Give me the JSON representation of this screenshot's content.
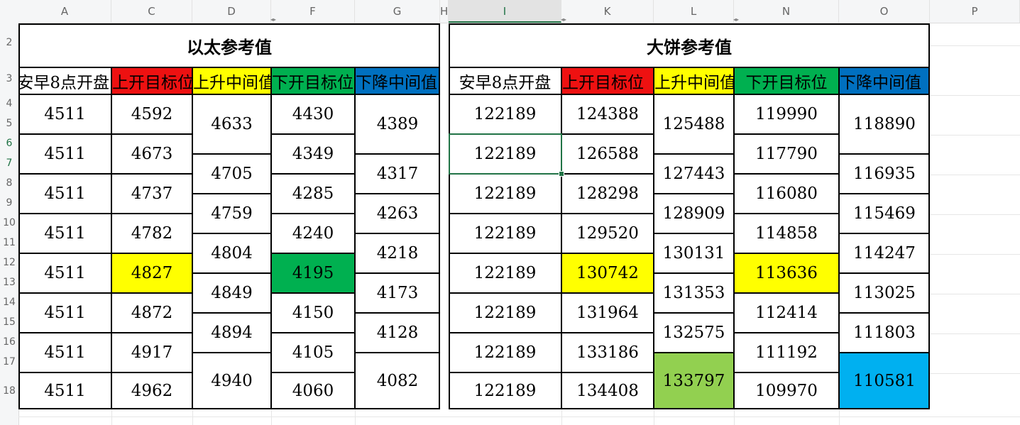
{
  "columns": {
    "left": [
      "A",
      "C",
      "D",
      "F",
      "G"
    ],
    "gap": "H",
    "right": [
      "I",
      "K",
      "L",
      "N",
      "O"
    ],
    "extra": "P",
    "selected": "I"
  },
  "rows": {
    "labels": [
      "2",
      "3",
      "4",
      "5",
      "6",
      "7",
      "8",
      "9",
      "10",
      "11",
      "12",
      "13",
      "14",
      "15",
      "16",
      "17",
      "18"
    ],
    "selected": [
      "6",
      "7"
    ]
  },
  "eth": {
    "title": "以太参考值",
    "headers": [
      "安早8点开盘",
      "上开目标位",
      "上升中间值",
      "下开目标位",
      "下降中间值"
    ],
    "open": [
      "4511",
      "4511",
      "4511",
      "4511",
      "4511",
      "4511",
      "4511",
      "4511"
    ],
    "up_target": [
      "4592",
      "4673",
      "4737",
      "4782",
      "4827",
      "4872",
      "4917",
      "4962"
    ],
    "up_mid": [
      "4633",
      "4705",
      "4759",
      "4804",
      "4849",
      "4894",
      "4940"
    ],
    "down_target": [
      "4430",
      "4349",
      "4285",
      "4240",
      "4195",
      "4150",
      "4105",
      "4060"
    ],
    "down_mid": [
      "4389",
      "4317",
      "4263",
      "4218",
      "4173",
      "4128",
      "4082"
    ]
  },
  "btc": {
    "title": "大饼参考值",
    "headers": [
      "安早8点开盘",
      "上开目标位",
      "上升中间值",
      "下开目标位",
      "下降中间值"
    ],
    "open": [
      "122189",
      "122189",
      "122189",
      "122189",
      "122189",
      "122189",
      "122189",
      "122189"
    ],
    "up_target": [
      "124388",
      "126588",
      "128298",
      "129520",
      "130742",
      "131964",
      "133186",
      "134408"
    ],
    "up_mid": [
      "125488",
      "127443",
      "128909",
      "130131",
      "131353",
      "132575",
      "133797"
    ],
    "down_target": [
      "119990",
      "117790",
      "116080",
      "114858",
      "113636",
      "112414",
      "111192",
      "109970"
    ],
    "down_mid": [
      "118890",
      "116935",
      "115469",
      "114247",
      "113025",
      "111803",
      "110581"
    ]
  },
  "colors": {
    "red": "#ee1111",
    "yellow": "#ffff00",
    "green": "#00b050",
    "blue": "#0070c0",
    "light_green": "#92d050",
    "light_blue": "#00b0f0",
    "selection": "#217346"
  }
}
